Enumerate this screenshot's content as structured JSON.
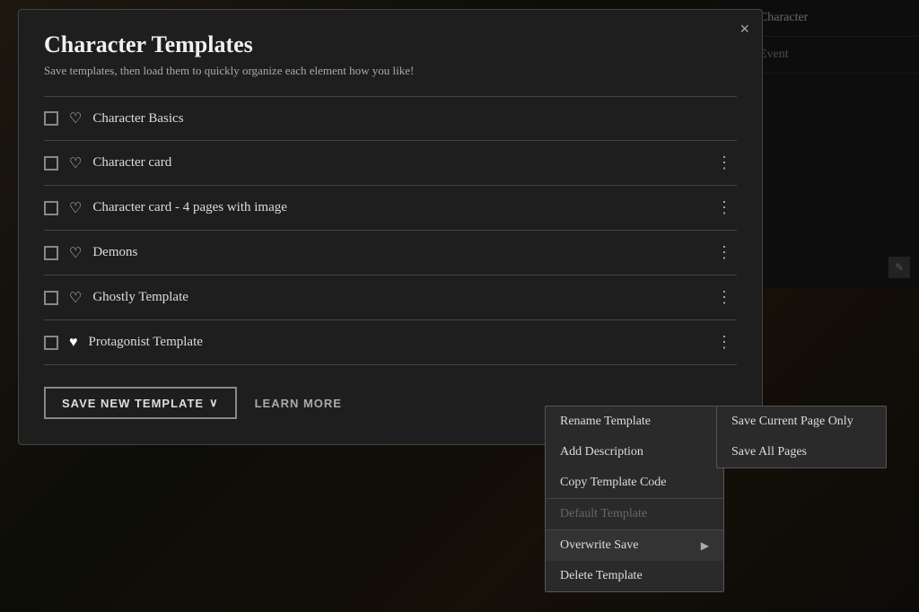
{
  "background": {
    "character_label": "Character",
    "event_label": "Event"
  },
  "dialog": {
    "title": "Character Templates",
    "subtitle": "Save templates, then load them to quickly organize each element how you like!",
    "close_label": "×",
    "templates": [
      {
        "id": 1,
        "name": "Character Basics",
        "heart_filled": false,
        "show_menu": false
      },
      {
        "id": 2,
        "name": "Character card",
        "heart_filled": false,
        "show_menu": true
      },
      {
        "id": 3,
        "name": "Character card - 4 pages with image",
        "heart_filled": false,
        "show_menu": true
      },
      {
        "id": 4,
        "name": "Demons",
        "heart_filled": false,
        "show_menu": true
      },
      {
        "id": 5,
        "name": "Ghostly Template",
        "heart_filled": false,
        "show_menu": true
      },
      {
        "id": 6,
        "name": "Protagonist Template",
        "heart_filled": true,
        "show_menu": true
      }
    ],
    "footer": {
      "save_new_label": "SAVE NEW TEMPLATE",
      "save_new_chevron": "∨",
      "learn_more_label": "LEARN MORE"
    }
  },
  "context_menu": {
    "items": [
      {
        "id": "rename",
        "label": "Rename Template",
        "disabled": false,
        "has_submenu": false
      },
      {
        "id": "add-desc",
        "label": "Add Description",
        "disabled": false,
        "has_submenu": false
      },
      {
        "id": "copy-code",
        "label": "Copy Template Code",
        "disabled": false,
        "has_submenu": false
      },
      {
        "id": "default",
        "label": "Default Template",
        "disabled": true,
        "has_submenu": false
      },
      {
        "id": "overwrite",
        "label": "Overwrite Save",
        "disabled": false,
        "has_submenu": true
      },
      {
        "id": "delete",
        "label": "Delete Template",
        "disabled": false,
        "has_submenu": false
      }
    ]
  },
  "submenu": {
    "items": [
      {
        "id": "save-page",
        "label": "Save Current Page Only"
      },
      {
        "id": "save-all",
        "label": "Save All Pages"
      }
    ]
  }
}
